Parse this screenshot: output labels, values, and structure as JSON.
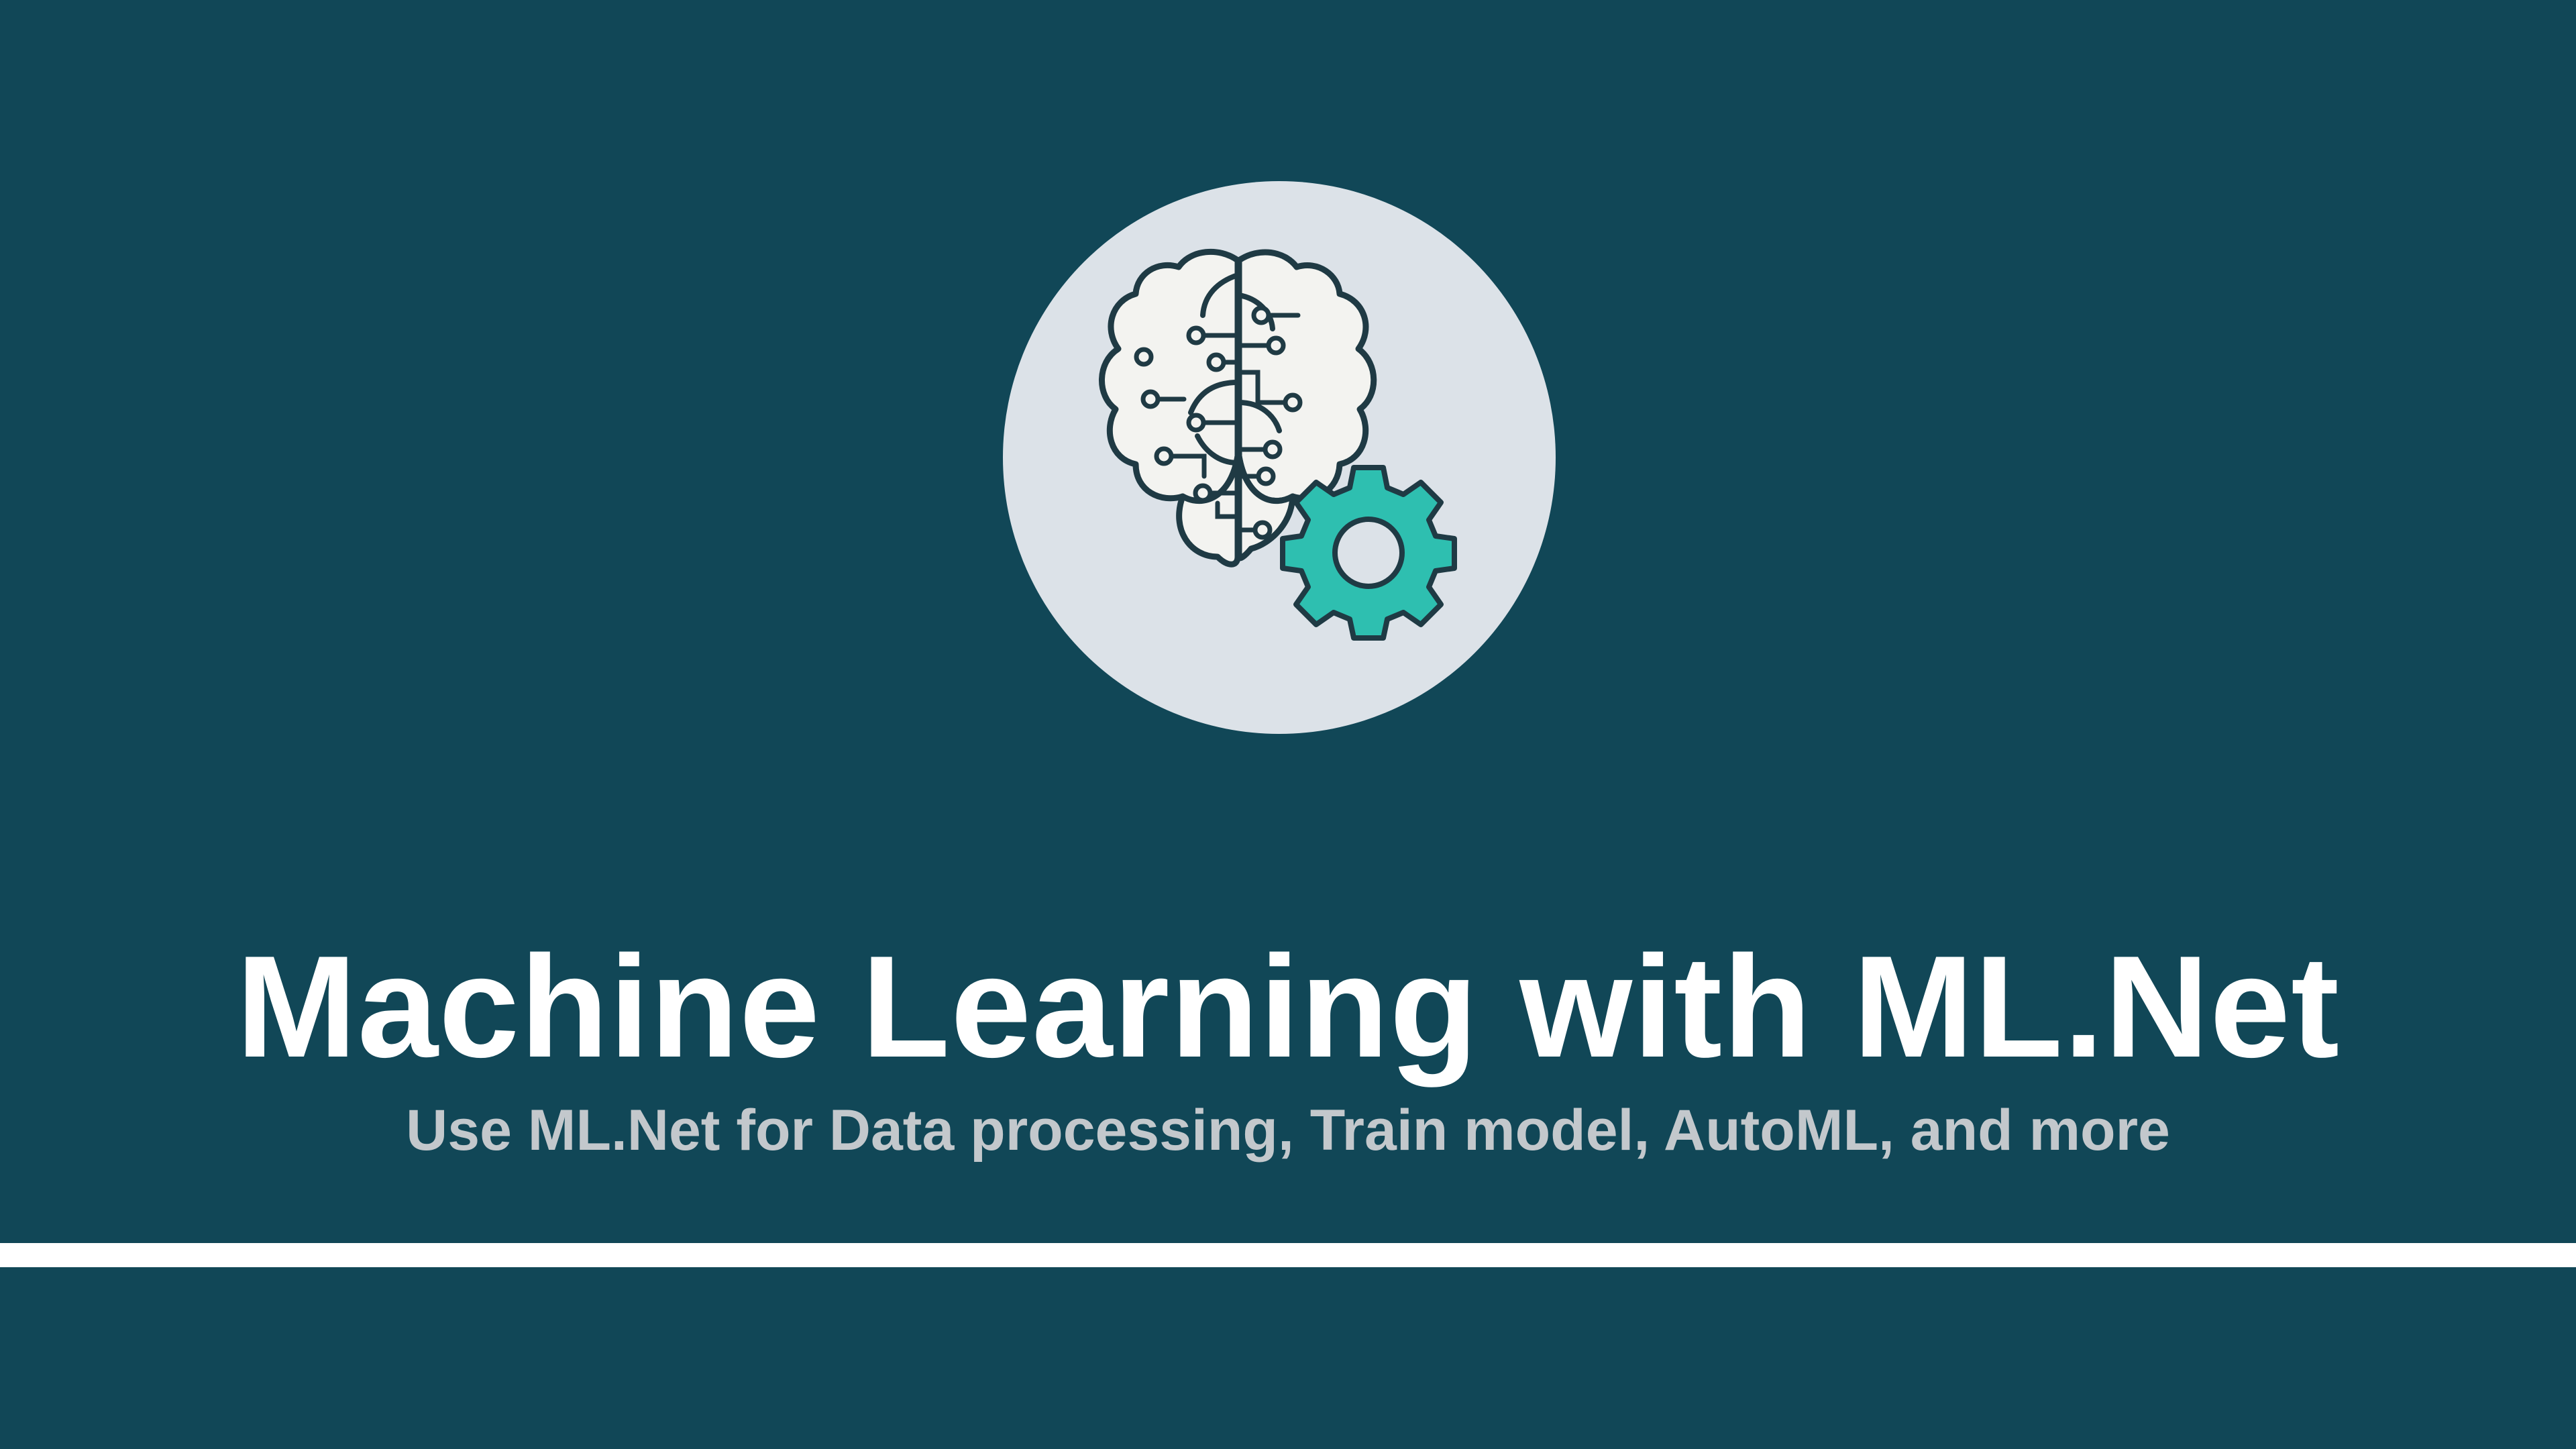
{
  "logo": {
    "icon": "brain-gear-icon",
    "circle_color": "#dce2e8",
    "brain_color": "#f3f3f0",
    "outline_color": "#1f3a44",
    "gear_color": "#2ebfb0"
  },
  "title": "Machine Learning with ML.Net",
  "subtitle": "Use ML.Net for Data processing, Train model, AutoML, and more",
  "colors": {
    "background": "#114757",
    "title": "#ffffff",
    "subtitle": "#c3c8cc",
    "divider": "#ffffff"
  }
}
